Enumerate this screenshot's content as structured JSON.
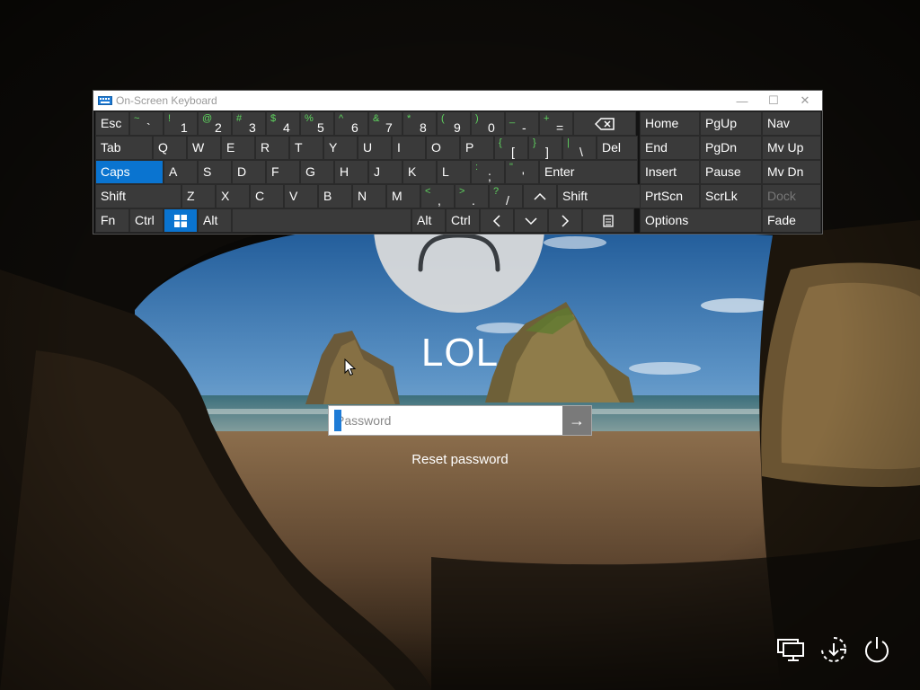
{
  "window": {
    "title": "On-Screen Keyboard",
    "minimize": "—",
    "maximize": "☐",
    "close": "✕"
  },
  "keyboard": {
    "row1": [
      {
        "label": "Esc"
      },
      {
        "shift": "~",
        "main": "`"
      },
      {
        "shift": "!",
        "main": "1"
      },
      {
        "shift": "@",
        "main": "2"
      },
      {
        "shift": "#",
        "main": "3"
      },
      {
        "shift": "$",
        "main": "4"
      },
      {
        "shift": "%",
        "main": "5"
      },
      {
        "shift": "^",
        "main": "6"
      },
      {
        "shift": "&",
        "main": "7"
      },
      {
        "shift": "*",
        "main": "8"
      },
      {
        "shift": "(",
        "main": "9"
      },
      {
        "shift": ")",
        "main": "0"
      },
      {
        "shift": "_",
        "main": "-"
      },
      {
        "shift": "+",
        "main": "="
      },
      {
        "icon": "backspace-icon"
      }
    ],
    "row2": [
      {
        "label": "Tab"
      },
      {
        "label": "Q"
      },
      {
        "label": "W"
      },
      {
        "label": "E"
      },
      {
        "label": "R"
      },
      {
        "label": "T"
      },
      {
        "label": "Y"
      },
      {
        "label": "U"
      },
      {
        "label": "I"
      },
      {
        "label": "O"
      },
      {
        "label": "P"
      },
      {
        "shift": "{",
        "main": "["
      },
      {
        "shift": "}",
        "main": "]"
      },
      {
        "shift": "|",
        "main": "\\"
      },
      {
        "label": "Del"
      }
    ],
    "row3": [
      {
        "label": "Caps"
      },
      {
        "label": "A"
      },
      {
        "label": "S"
      },
      {
        "label": "D"
      },
      {
        "label": "F"
      },
      {
        "label": "G"
      },
      {
        "label": "H"
      },
      {
        "label": "J"
      },
      {
        "label": "K"
      },
      {
        "label": "L"
      },
      {
        "shift": ":",
        "main": ";"
      },
      {
        "shift": "\"",
        "main": "'"
      },
      {
        "label": "Enter"
      }
    ],
    "row4": [
      {
        "label": "Shift"
      },
      {
        "label": "Z"
      },
      {
        "label": "X"
      },
      {
        "label": "C"
      },
      {
        "label": "V"
      },
      {
        "label": "B"
      },
      {
        "label": "N"
      },
      {
        "label": "M"
      },
      {
        "shift": "<",
        "main": ","
      },
      {
        "shift": ">",
        "main": "."
      },
      {
        "shift": "?",
        "main": "/"
      },
      {
        "icon": "arrow-up-icon"
      },
      {
        "label": "Shift"
      }
    ],
    "row5": [
      {
        "label": "Fn"
      },
      {
        "label": "Ctrl"
      },
      {
        "icon": "windows-icon"
      },
      {
        "label": "Alt"
      },
      {
        "label": ""
      },
      {
        "label": "Alt"
      },
      {
        "label": "Ctrl"
      },
      {
        "icon": "arrow-left-icon"
      },
      {
        "icon": "arrow-down-icon"
      },
      {
        "icon": "arrow-right-icon"
      },
      {
        "icon": "menu-icon"
      }
    ],
    "nav": [
      {
        "label": "Home"
      },
      {
        "label": "PgUp"
      },
      {
        "label": "Nav"
      },
      {
        "label": "End"
      },
      {
        "label": "PgDn"
      },
      {
        "label": "Mv Up"
      },
      {
        "label": "Insert"
      },
      {
        "label": "Pause"
      },
      {
        "label": "Mv Dn"
      },
      {
        "label": "PrtScn"
      },
      {
        "label": "ScrLk"
      },
      {
        "label": "Dock"
      },
      {
        "label": "Options"
      },
      {
        "label": "Fade"
      }
    ],
    "active_key": "Caps",
    "disabled_key": "Dock",
    "colors": {
      "key_bg": "#3a3a3a",
      "active": "#0a74d0",
      "shift_text": "#5fd45f"
    }
  },
  "login": {
    "username": "LOL",
    "password_placeholder": "Password",
    "password_value": "",
    "submit_icon": "arrow-right-icon",
    "reset_link": "Reset password"
  },
  "system_icons": [
    "network-icon",
    "ease-of-access-icon",
    "power-icon"
  ]
}
